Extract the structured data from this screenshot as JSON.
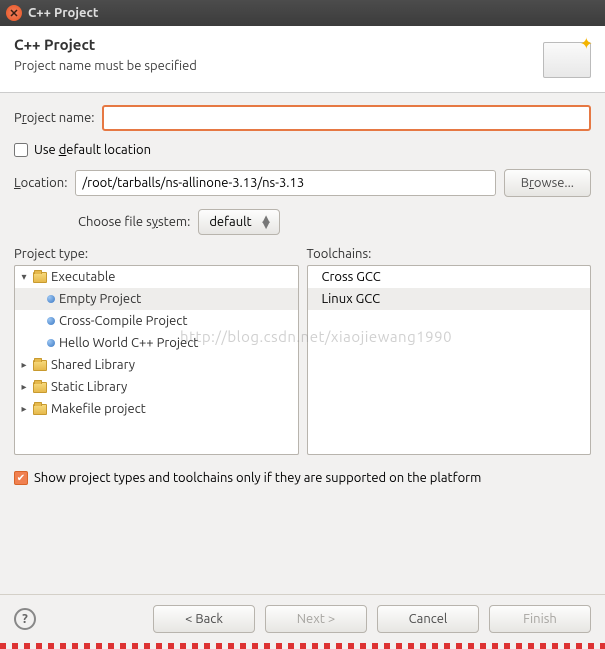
{
  "titlebar": {
    "title": "C++ Project"
  },
  "banner": {
    "heading": "C++ Project",
    "message": "Project name must be specified"
  },
  "project_name": {
    "label_pre": "P",
    "label_u": "r",
    "label_post": "oject name:",
    "value": ""
  },
  "use_default": {
    "label_pre": "Use ",
    "label_u": "d",
    "label_post": "efault location",
    "checked": false
  },
  "location": {
    "label_pre": "",
    "label_u": "L",
    "label_post": "ocation:",
    "value": "/root/tarballs/ns-allinone-3.13/ns-3.13",
    "browse_pre": "B",
    "browse_u": "r",
    "browse_post": "owse..."
  },
  "filesystem": {
    "label_pre": "Choose file s",
    "label_u": "y",
    "label_post": "stem:",
    "value": "default"
  },
  "project_type": {
    "header": "Project type:",
    "nodes": [
      {
        "label": "Executable",
        "expanded": true,
        "children": [
          {
            "label": "Empty Project",
            "selected": true
          },
          {
            "label": "Cross-Compile Project"
          },
          {
            "label": "Hello World C++ Project"
          }
        ]
      },
      {
        "label": "Shared Library",
        "expanded": false
      },
      {
        "label": "Static Library",
        "expanded": false
      },
      {
        "label": "Makefile project",
        "expanded": false
      }
    ]
  },
  "toolchains": {
    "header": "Toolchains:",
    "items": [
      {
        "label": "Cross GCC",
        "selected": false
      },
      {
        "label": "Linux GCC",
        "selected": true
      }
    ]
  },
  "show_supported": {
    "label": "Show project types and toolchains only if they are supported on the platform",
    "checked": true
  },
  "buttons": {
    "back": "< Back",
    "next": "Next >",
    "cancel": "Cancel",
    "finish": "Finish",
    "help": "?"
  },
  "watermark": "http://blog.csdn.net/xiaojiewang1990"
}
